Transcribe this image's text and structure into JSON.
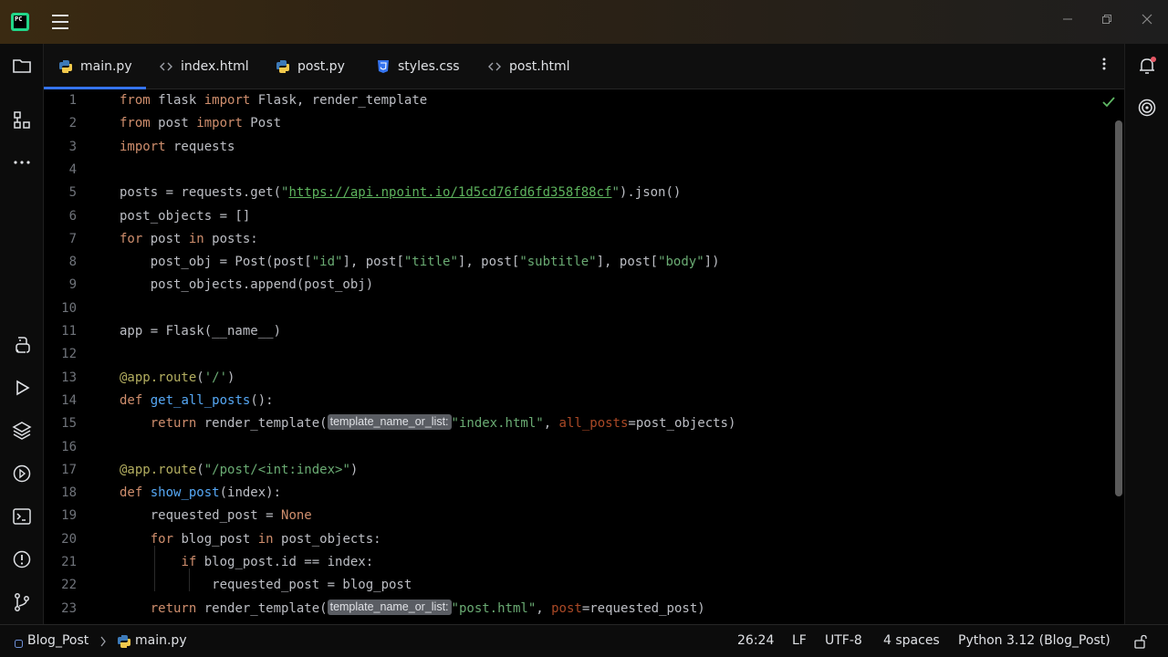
{
  "titlebar": {
    "logo_text": "PC"
  },
  "tabs": [
    {
      "label": "main.py",
      "icon": "python-file-icon",
      "active": true
    },
    {
      "label": "index.html",
      "icon": "html-file-icon",
      "active": false
    },
    {
      "label": "post.py",
      "icon": "python-file-icon",
      "active": false
    },
    {
      "label": "styles.css",
      "icon": "css-file-icon",
      "active": false
    },
    {
      "label": "post.html",
      "icon": "html-file-icon",
      "active": false
    }
  ],
  "editor": {
    "lines": [
      {
        "n": "1",
        "code": [
          [
            "kw",
            "from"
          ],
          [
            "t",
            " flask "
          ],
          [
            "kw",
            "import"
          ],
          [
            "t",
            " Flask, render_template"
          ]
        ]
      },
      {
        "n": "2",
        "code": [
          [
            "kw",
            "from"
          ],
          [
            "t",
            " post "
          ],
          [
            "kw",
            "import"
          ],
          [
            "t",
            " Post"
          ]
        ]
      },
      {
        "n": "3",
        "code": [
          [
            "kw",
            "import"
          ],
          [
            "t",
            " requests"
          ]
        ]
      },
      {
        "n": "4",
        "code": []
      },
      {
        "n": "5",
        "code": [
          [
            "t",
            "posts = requests.get("
          ],
          [
            "str",
            "\""
          ],
          [
            "url",
            "https://api.npoint.io/1d5cd76fd6fd358f88cf"
          ],
          [
            "str",
            "\""
          ],
          [
            "t",
            ").json()"
          ]
        ]
      },
      {
        "n": "6",
        "code": [
          [
            "t",
            "post_objects = []"
          ]
        ]
      },
      {
        "n": "7",
        "code": [
          [
            "kw",
            "for"
          ],
          [
            "t",
            " post "
          ],
          [
            "kw",
            "in"
          ],
          [
            "t",
            " posts:"
          ]
        ]
      },
      {
        "n": "8",
        "code": [
          [
            "t",
            "    post_obj = Post(post["
          ],
          [
            "str",
            "\"id\""
          ],
          [
            "t",
            "], post["
          ],
          [
            "str",
            "\"title\""
          ],
          [
            "t",
            "], post["
          ],
          [
            "str",
            "\"subtitle\""
          ],
          [
            "t",
            "], post["
          ],
          [
            "str",
            "\"body\""
          ],
          [
            "t",
            "])"
          ]
        ]
      },
      {
        "n": "9",
        "code": [
          [
            "t",
            "    post_objects.append(post_obj)"
          ]
        ]
      },
      {
        "n": "10",
        "code": []
      },
      {
        "n": "11",
        "code": [
          [
            "t",
            "app = Flask(__name__)"
          ]
        ]
      },
      {
        "n": "12",
        "code": []
      },
      {
        "n": "13",
        "code": [
          [
            "dec",
            "@app.route"
          ],
          [
            "t",
            "("
          ],
          [
            "str",
            "'/'"
          ],
          [
            "t",
            ")"
          ]
        ]
      },
      {
        "n": "14",
        "code": [
          [
            "kw",
            "def"
          ],
          [
            "t",
            " "
          ],
          [
            "fn",
            "get_all_posts"
          ],
          [
            "t",
            "():"
          ]
        ]
      },
      {
        "n": "15",
        "code": [
          [
            "t",
            "    "
          ],
          [
            "kw",
            "return"
          ],
          [
            "t",
            " render_template("
          ],
          [
            "hint",
            "template_name_or_list:"
          ],
          [
            "str",
            "\"index.html\""
          ],
          [
            "t",
            ", "
          ],
          [
            "param",
            "all_posts"
          ],
          [
            "t",
            "=post_objects)"
          ]
        ]
      },
      {
        "n": "16",
        "code": []
      },
      {
        "n": "17",
        "code": [
          [
            "dec",
            "@app.route"
          ],
          [
            "t",
            "("
          ],
          [
            "str",
            "\"/post/<int:index>\""
          ],
          [
            "t",
            ")"
          ]
        ]
      },
      {
        "n": "18",
        "code": [
          [
            "kw",
            "def"
          ],
          [
            "t",
            " "
          ],
          [
            "fn",
            "show_post"
          ],
          [
            "t",
            "(index):"
          ]
        ]
      },
      {
        "n": "19",
        "code": [
          [
            "t",
            "    requested_post = "
          ],
          [
            "none",
            "None"
          ]
        ]
      },
      {
        "n": "20",
        "code": [
          [
            "t",
            "    "
          ],
          [
            "kw",
            "for"
          ],
          [
            "t",
            " blog_post "
          ],
          [
            "kw",
            "in"
          ],
          [
            "t",
            " post_objects:"
          ]
        ]
      },
      {
        "n": "21",
        "code": [
          [
            "t",
            "        "
          ],
          [
            "kw",
            "if"
          ],
          [
            "t",
            " blog_post.id == index:"
          ]
        ]
      },
      {
        "n": "22",
        "code": [
          [
            "t",
            "            requested_post = blog_post"
          ]
        ]
      },
      {
        "n": "23",
        "code": [
          [
            "t",
            "    "
          ],
          [
            "kw",
            "return"
          ],
          [
            "t",
            " render_template("
          ],
          [
            "hint",
            "template_name_or_list:"
          ],
          [
            "str",
            "\"post.html\""
          ],
          [
            "t",
            ", "
          ],
          [
            "param",
            "post"
          ],
          [
            "t",
            "=requested_post)"
          ]
        ]
      }
    ]
  },
  "statusbar": {
    "project": "Blog_Post",
    "file": "main.py",
    "position": "26:24",
    "line_ending": "LF",
    "encoding": "UTF-8",
    "indent": "4 spaces",
    "interpreter": "Python 3.12 (Blog_Post)"
  },
  "colors": {
    "keyword": "#cf8e6d",
    "string": "#6aab73",
    "decorator": "#b3ae60",
    "function": "#56a8f5",
    "accent": "#3574f0"
  }
}
